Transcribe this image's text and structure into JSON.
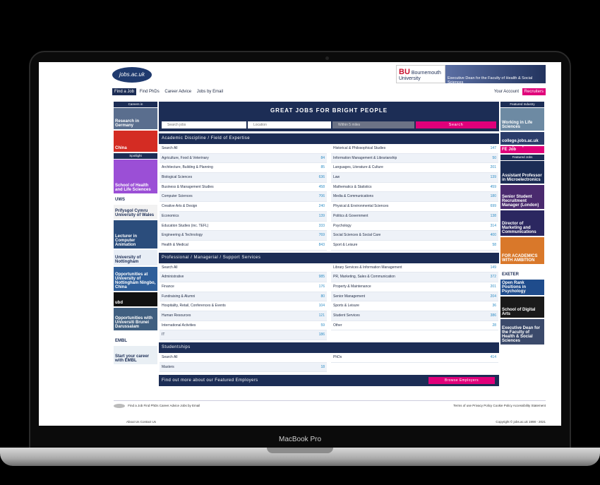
{
  "device_label": "MacBook Pro",
  "header": {
    "logo_text": "jobs.ac.uk",
    "banner_org": "Bournemouth",
    "banner_org2": "University",
    "banner_text": "Executive Dean for the Faculty of Health & Social Sciences"
  },
  "nav": {
    "items": [
      "Find a Job",
      "Find PhDs",
      "Career Advice",
      "Jobs by Email"
    ],
    "account": "Your Account",
    "recruiters": "Recruiters"
  },
  "left_column": {
    "heading": "Careers in",
    "spotlight": "Spotlight",
    "tiles": [
      {
        "label": "Research in Germany",
        "color": "#5a6e8e"
      },
      {
        "label": "China",
        "color": "#d42c23"
      },
      {
        "label": "School of Health and Life Sciences",
        "color": "#9b4fd6"
      },
      {
        "label": "UWS",
        "color": "#ffffff"
      },
      {
        "label": "Prifysgol Cymru University of Wales",
        "color": "#f2f2f2"
      },
      {
        "label": "Lecturer in Computer Animation",
        "color": "#2b4d7c"
      },
      {
        "label": "University of Nottingham",
        "color": "#e8eef6"
      },
      {
        "label": "Opportunities at University of Nottingham Ningbo, China",
        "color": "#2f5f9a"
      },
      {
        "label": "ubd",
        "color": "#111111"
      },
      {
        "label": "Opportunities with Universiti Brunei Darussalam",
        "color": "#405f80"
      },
      {
        "label": "EMBL",
        "color": "#ffffff"
      },
      {
        "label": "Start your career with EMBL",
        "color": "#e9eff4"
      }
    ]
  },
  "right_column": {
    "heading": "Featured Industry",
    "featured_jobs": "Featured Jobs",
    "tiles": [
      {
        "label": "Working in Life Sciences",
        "color": "#6d8aa3"
      },
      {
        "label": "college.jobs.ac.uk",
        "color": "#2b3d6b"
      },
      {
        "label": "Find your perfect FE Job",
        "color": "#e0007a"
      },
      {
        "label": "Assistant Professor in Microelectronics",
        "color": "#1c2d55"
      },
      {
        "label": "Senior Student Recruitment Manager (London)",
        "color": "#4a2a6e"
      },
      {
        "label": "Director of Marketing and Communications",
        "color": "#2b2760"
      },
      {
        "label": "FOR ACADEMICS WITH AMBITION",
        "color": "#d9782a"
      },
      {
        "label": "EXETER",
        "color": "#ffffff"
      },
      {
        "label": "Open Rank Positions in Psychology",
        "color": "#1f4c8c"
      },
      {
        "label": "School of Digital Arts",
        "color": "#1a1a1a"
      },
      {
        "label": "Executive Dean for the Faculty of Health & Social Sciences",
        "color": "#3b4a6b"
      }
    ]
  },
  "hero": {
    "title": "GREAT JOBS FOR BRIGHT PEOPLE",
    "search_placeholder": "Search jobs",
    "location_placeholder": "Location",
    "distance": "Within 5 miles",
    "search_button": "Search"
  },
  "sections": [
    {
      "title": "Academic Discipline / Field of Expertise",
      "left": [
        [
          "Search All",
          ""
        ],
        [
          "Agriculture, Food & Veterinary",
          "84"
        ],
        [
          "Architecture, Building & Planning",
          "85"
        ],
        [
          "Biological Sciences",
          "636"
        ],
        [
          "Business & Management Studies",
          "458"
        ],
        [
          "Computer Sciences",
          "706"
        ],
        [
          "Creative Arts & Design",
          "240"
        ],
        [
          "Economics",
          "139"
        ],
        [
          "Education Studies (inc. TEFL)",
          "333"
        ],
        [
          "Engineering & Technology",
          "769"
        ],
        [
          "Health & Medical",
          "843"
        ]
      ],
      "right": [
        [
          "Historical & Philosophical Studies",
          "147"
        ],
        [
          "Information Management & Librarianship",
          "50"
        ],
        [
          "Languages, Literature & Culture",
          "201"
        ],
        [
          "Law",
          "139"
        ],
        [
          "Mathematics & Statistics",
          "459"
        ],
        [
          "Media & Communications",
          "180"
        ],
        [
          "Physical & Environmental Sciences",
          "699"
        ],
        [
          "Politics & Government",
          "138"
        ],
        [
          "Psychology",
          "314"
        ],
        [
          "Social Sciences & Social Care",
          "400"
        ],
        [
          "Sport & Leisure",
          "58"
        ]
      ]
    },
    {
      "title": "Professional / Managerial / Support Services",
      "left": [
        [
          "Search All",
          ""
        ],
        [
          "Administrative",
          "985"
        ],
        [
          "Finance",
          "176"
        ],
        [
          "Fundraising & Alumni",
          "80"
        ],
        [
          "Hospitality, Retail, Conferences & Events",
          "104"
        ],
        [
          "Human Resources",
          "121"
        ],
        [
          "International Activities",
          "59"
        ],
        [
          "IT",
          "186"
        ]
      ],
      "right": [
        [
          "Library Services & Information Management",
          "149"
        ],
        [
          "PR, Marketing, Sales & Communication",
          "372"
        ],
        [
          "Property & Maintenance",
          "201"
        ],
        [
          "Senior Management",
          "204"
        ],
        [
          "Sports & Leisure",
          "36"
        ],
        [
          "Student Services",
          "386"
        ],
        [
          "Other",
          "28"
        ]
      ]
    },
    {
      "title": "Studentships",
      "left": [
        [
          "Search All",
          ""
        ],
        [
          "Masters",
          "18"
        ]
      ],
      "right": [
        [
          "PhDs",
          "414"
        ]
      ]
    }
  ],
  "featured_employers": {
    "text": "Find out more about our Featured Employers",
    "button": "Browse Employers"
  },
  "footer": {
    "links": "Find a Job  Find PhDs  Career Advice  Jobs by Email",
    "legal": "Terms of use  Privacy Policy  Cookie Policy  Accessibility Statement",
    "about": "About Us  Contact Us",
    "copyright": "Copyright © jobs.ac.uk 1998 - 2021"
  }
}
